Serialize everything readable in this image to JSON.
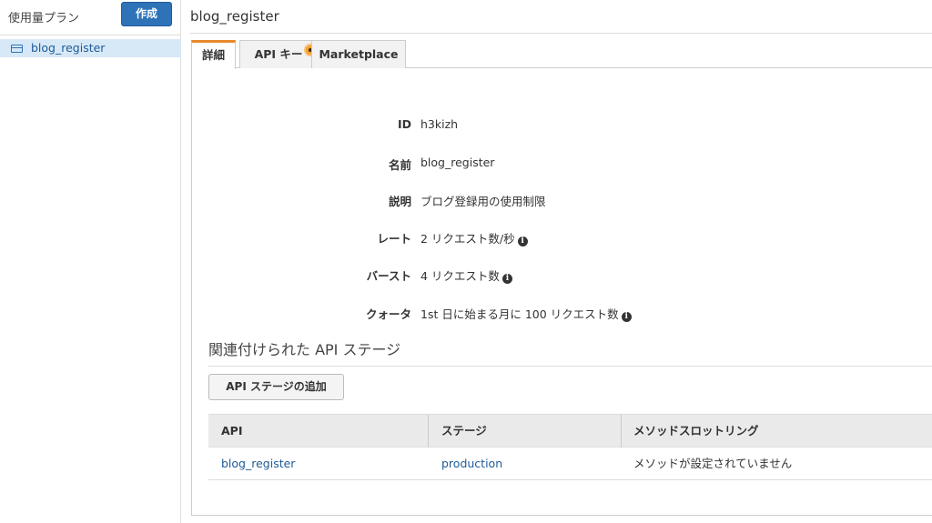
{
  "sidebar": {
    "title": "使用量プラン",
    "create_label": "作成",
    "items": [
      {
        "label": "blog_register",
        "icon": "usage-plan-icon"
      }
    ]
  },
  "main": {
    "title": "blog_register",
    "tabs": [
      {
        "label": "詳細",
        "active": true
      },
      {
        "label": "API キー",
        "active": false
      },
      {
        "label": "Marketplace",
        "active": false
      }
    ],
    "details": [
      {
        "label": "ID",
        "value": "h3kizh",
        "info": false
      },
      {
        "label": "名前",
        "value": "blog_register",
        "info": false
      },
      {
        "label": "説明",
        "value": "ブログ登録用の使用制限",
        "info": false
      },
      {
        "label": "レート",
        "value": "2 リクエスト数/秒",
        "info": true
      },
      {
        "label": "バースト",
        "value": "4 リクエスト数",
        "info": true
      },
      {
        "label": "クォータ",
        "value": "1st 日に始まる月に 100 リクエスト数",
        "info": true
      }
    ],
    "info_glyph": "i",
    "stages_section": {
      "title": "関連付けられた API ステージ",
      "add_button": "API ステージの追加",
      "columns": [
        "API",
        "ステージ",
        "メソッドスロットリング"
      ],
      "rows": [
        {
          "api": "blog_register",
          "stage": "production",
          "throttling": "メソッドが設定されていません"
        }
      ]
    }
  },
  "colors": {
    "primary_button": "#2e73b8",
    "link": "#1e5c98",
    "active_tab_accent": "#e8892b",
    "selected_item_bg": "#d7e8f7"
  }
}
